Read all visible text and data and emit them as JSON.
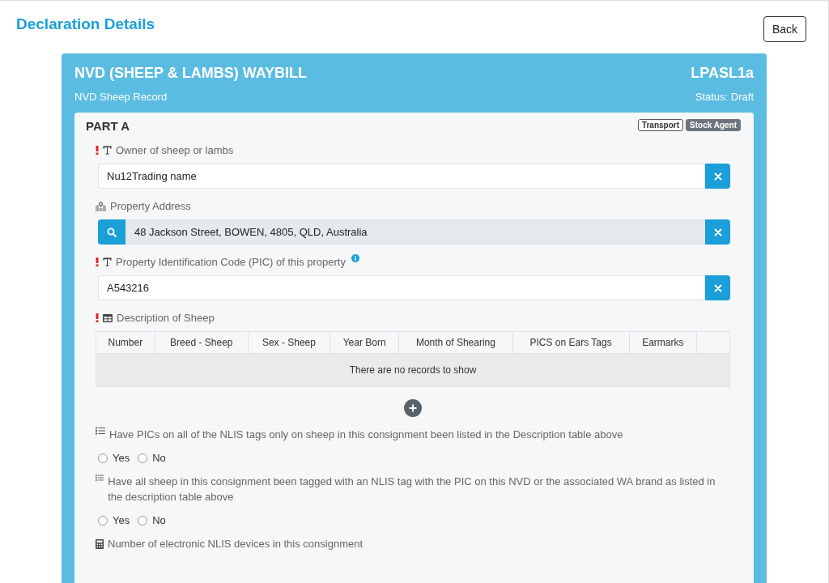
{
  "page": {
    "title": "Declaration Details",
    "back_button": "Back"
  },
  "form": {
    "title": "NVD (SHEEP & LAMBS) WAYBILL",
    "code": "LPASL1a",
    "subtitle": "NVD Sheep Record",
    "status": "Status: Draft"
  },
  "part": {
    "title": "PART A",
    "badges": [
      {
        "label": "Transport",
        "kind": "outline"
      },
      {
        "label": "Stock Agent",
        "kind": "filled"
      }
    ]
  },
  "fields": [
    {
      "kind": "text",
      "required": true,
      "label": "Owner of sheep or lambs",
      "value": "Nu12Trading name"
    },
    {
      "kind": "address",
      "required": false,
      "label": "Property Address",
      "value": "48 Jackson Street, BOWEN, 4805, QLD, Australia"
    },
    {
      "kind": "text",
      "required": true,
      "info": true,
      "label": "Property Identification Code (PIC) of this property",
      "value": "A543216"
    },
    {
      "kind": "table",
      "required": true,
      "label": "Description of Sheep",
      "columns": [
        "Number",
        "Breed - Sheep",
        "Sex - Sheep",
        "Year Born",
        "Month of Shearing",
        "PICS on Ears Tags",
        "Earmarks"
      ],
      "empty_text": "There are no records to show"
    },
    {
      "kind": "radio",
      "required": false,
      "label": "Have PICs on all of the NLIS tags only on sheep in this consignment been listed in the Description table above",
      "options": [
        {
          "label": "Yes",
          "selected": false
        },
        {
          "label": "No",
          "selected": false
        }
      ]
    },
    {
      "kind": "radio",
      "required": false,
      "label": "Have all sheep in this consignment been tagged with an NLIS tag with the PIC on this NVD or the associated WA brand as listed in the description table above",
      "options": [
        {
          "label": "Yes",
          "selected": false
        },
        {
          "label": "No",
          "selected": false
        }
      ]
    },
    {
      "kind": "number",
      "required": false,
      "label": "Number of electronic NLIS devices in this consignment"
    }
  ]
}
